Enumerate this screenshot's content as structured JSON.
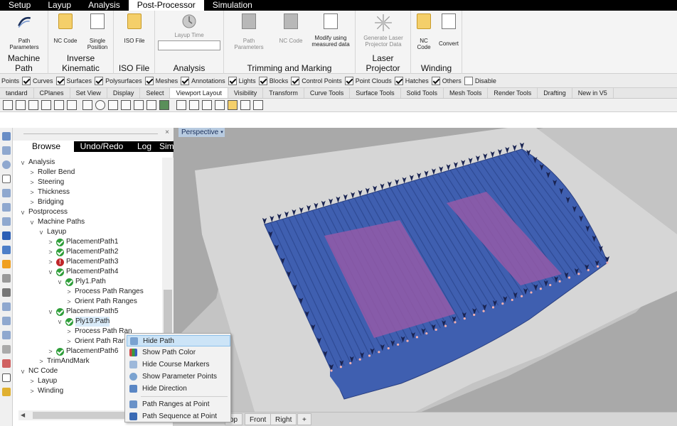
{
  "main_tabs": [
    "Setup",
    "Layup",
    "Analysis",
    "Post-Processor",
    "Simulation"
  ],
  "active_main_tab": "Post-Processor",
  "ribbon": {
    "machine_path": {
      "label": "Machine Path",
      "button": "Path Parameters"
    },
    "inverse_kinematic": {
      "label": "Inverse Kinematic",
      "buttons": [
        "NC Code",
        "Single Position"
      ]
    },
    "iso_file": {
      "label": "ISO File",
      "button": "ISO File"
    },
    "analysis": {
      "label": "Analysis",
      "button": "Layup Time",
      "field_value": ""
    },
    "trimming": {
      "label": "Trimming and Marking",
      "buttons": [
        "Path Parameters",
        "NC Code",
        "Modify using measured data"
      ]
    },
    "laser": {
      "label": "Laser Projector",
      "button": "Generate Laser Projector Data"
    },
    "winding": {
      "label": "Winding",
      "buttons": [
        "NC Code",
        "Convert"
      ]
    }
  },
  "osnap": [
    {
      "label": "Points",
      "checked": false
    },
    {
      "label": "Curves",
      "checked": true
    },
    {
      "label": "Surfaces",
      "checked": true
    },
    {
      "label": "Polysurfaces",
      "checked": true
    },
    {
      "label": "Meshes",
      "checked": true
    },
    {
      "label": "Annotations",
      "checked": true
    },
    {
      "label": "Lights",
      "checked": true
    },
    {
      "label": "Blocks",
      "checked": true
    },
    {
      "label": "Control Points",
      "checked": true
    },
    {
      "label": "Point Clouds",
      "checked": true
    },
    {
      "label": "Hatches",
      "checked": true
    },
    {
      "label": "Others",
      "checked": true
    },
    {
      "label": "Disable",
      "checked": false
    }
  ],
  "toolbar_tabs": [
    "tandard",
    "CPlanes",
    "Set View",
    "Display",
    "Select",
    "Viewport Layout",
    "Visibility",
    "Transform",
    "Curve Tools",
    "Surface Tools",
    "Solid Tools",
    "Mesh Tools",
    "Render Tools",
    "Drafting",
    "New in V5"
  ],
  "active_toolbar_tab": "Viewport Layout",
  "panel": {
    "tabs": [
      "Browse",
      "Undo/Redo",
      "Log",
      "Simu"
    ],
    "active_tab": "Browse",
    "close_glyph": "×",
    "tree": [
      {
        "label": "Analysis",
        "twisty": "v",
        "status": ""
      },
      {
        "label": "Roller Bend",
        "twisty": ">",
        "status": ""
      },
      {
        "label": "Steering",
        "twisty": ">",
        "status": ""
      },
      {
        "label": "Thickness",
        "twisty": ">",
        "status": ""
      },
      {
        "label": "Bridging",
        "twisty": ">",
        "status": ""
      },
      {
        "label": "Postprocess",
        "twisty": "v",
        "status": ""
      },
      {
        "label": "Machine Paths",
        "twisty": "v",
        "status": ""
      },
      {
        "label": "Layup",
        "twisty": "v",
        "status": ""
      },
      {
        "label": "PlacementPath1",
        "twisty": ">",
        "status": "ok"
      },
      {
        "label": "PlacementPath2",
        "twisty": ">",
        "status": "ok"
      },
      {
        "label": "PlacementPath3",
        "twisty": ">",
        "status": "err"
      },
      {
        "label": "PlacementPath4",
        "twisty": "v",
        "status": "ok"
      },
      {
        "label": "Ply1.Path",
        "twisty": "v",
        "status": "ok"
      },
      {
        "label": "Process Path Ranges",
        "twisty": ">",
        "status": ""
      },
      {
        "label": "Orient Path Ranges",
        "twisty": ">",
        "status": ""
      },
      {
        "label": "PlacementPath5",
        "twisty": "v",
        "status": "ok"
      },
      {
        "label": "Ply19.Path",
        "twisty": "v",
        "status": "ok"
      },
      {
        "label": "Process Path Ran",
        "twisty": ">",
        "status": ""
      },
      {
        "label": "Orient Path Rang",
        "twisty": ">",
        "status": ""
      },
      {
        "label": "PlacementPath6",
        "twisty": ">",
        "status": "ok"
      },
      {
        "label": "TrimAndMark",
        "twisty": ">",
        "status": ""
      },
      {
        "label": "NC Code",
        "twisty": "v",
        "status": ""
      },
      {
        "label": "Layup",
        "twisty": ">",
        "status": ""
      },
      {
        "label": "Winding",
        "twisty": ">",
        "status": ""
      }
    ]
  },
  "viewport": {
    "title": "Perspective",
    "menu_glyph": "▾",
    "tabs": [
      "op",
      "Front",
      "Right",
      "+"
    ]
  },
  "context_menu": [
    {
      "label": "Hide Path",
      "highlighted": true
    },
    {
      "label": "Show Path Color",
      "highlighted": false
    },
    {
      "label": "Hide Course Markers",
      "highlighted": false
    },
    {
      "label": "Show Parameter Points",
      "highlighted": false
    },
    {
      "label": "Hide Direction",
      "highlighted": false
    },
    {
      "label": "Path Ranges at Point",
      "highlighted": false
    },
    {
      "label": "Path Sequence at Point",
      "highlighted": false
    }
  ],
  "colors": {
    "tab_bar": "#000000",
    "ribbon_bg": "#f4f4f4",
    "viewport_bg": "#a9a9a9",
    "surface": "#d6d6d6",
    "path_blue": "#3f5fb0",
    "ply_purple": "#9a5aa8",
    "arrow_navy": "#1a2452",
    "ok_green": "#2f9e3a",
    "error_red": "#c0262a",
    "menu_highlight": "#cce4f7"
  },
  "icons": [
    "path-params-icon",
    "folder-icon",
    "page-icon",
    "clock-icon",
    "laser-icon",
    "check-icon",
    "error-icon"
  ]
}
